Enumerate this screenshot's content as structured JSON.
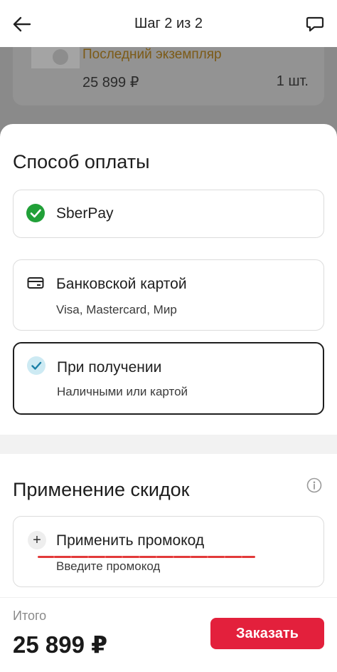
{
  "header": {
    "title": "Шаг 2 из 2",
    "back_icon": "arrow-left-icon",
    "chat_icon": "chat-bubble-icon"
  },
  "product": {
    "note": "Последний экземпляр",
    "price": "25 899 ₽",
    "quantity": "1 шт."
  },
  "payment": {
    "title": "Способ оплаты",
    "options": [
      {
        "title": "SberPay",
        "subtitle": "",
        "icon": "sberpay-check-icon",
        "selected": false
      },
      {
        "title": "Банковской картой",
        "subtitle": "Visa, Mastercard, Мир",
        "icon": "credit-card-icon",
        "selected": false
      },
      {
        "title": "При получении",
        "subtitle": "Наличными или картой",
        "icon": "check-circle-icon",
        "selected": true
      }
    ]
  },
  "discounts": {
    "title": "Применение скидок",
    "promo_title": "Применить промокод",
    "promo_subtitle": "Введите промокод"
  },
  "footer": {
    "total_label": "Итого",
    "total_value": "25 899 ₽",
    "order_button": "Заказать"
  },
  "colors": {
    "accent": "#e3203c",
    "sberpay_green": "#21a038",
    "selected_check_bg": "#cdeaf3",
    "selected_check": "#1a7fa6",
    "underline_red": "#e23a3a"
  }
}
